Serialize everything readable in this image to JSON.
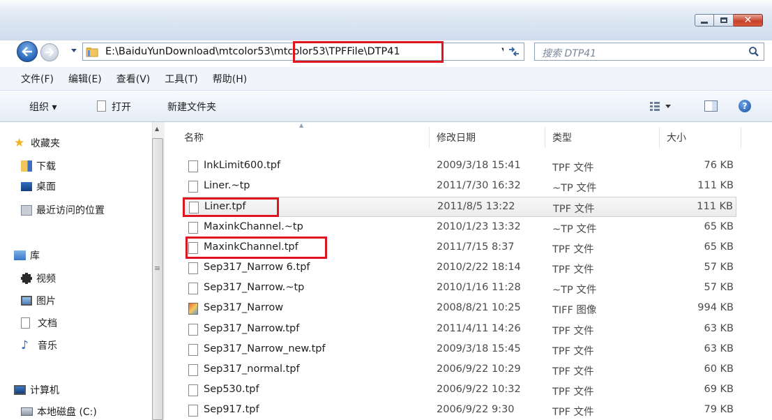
{
  "window": {
    "caption_buttons": [
      "minimize",
      "maximize",
      "close"
    ]
  },
  "address": {
    "path": "E:\\BaiduYunDownload\\mtcolor53\\mtcolor53\\TPFFile\\DTP41",
    "search_placeholder": "搜索 DTP41"
  },
  "menu": {
    "file": "文件(F)",
    "edit": "编辑(E)",
    "view": "查看(V)",
    "tools": "工具(T)",
    "help": "帮助(H)"
  },
  "toolbar": {
    "organize": "组织 ▾",
    "open": "打开",
    "new_folder": "新建文件夹"
  },
  "sidebar": {
    "favorites": "收藏夹",
    "downloads": "下载",
    "desktop": "桌面",
    "recent": "最近访问的位置",
    "libraries": "库",
    "videos": "视频",
    "pictures": "图片",
    "documents": "文档",
    "music": "音乐",
    "computer": "计算机",
    "local_disk": "本地磁盘 (C:)"
  },
  "columns": {
    "name": "名称",
    "date": "修改日期",
    "type": "类型",
    "size": "大小"
  },
  "files": [
    {
      "name": "InkLimit600.tpf",
      "date": "2009/3/18 15:41",
      "type": "TPF 文件",
      "size": "76 KB"
    },
    {
      "name": "Liner.~tp",
      "date": "2011/7/30 16:32",
      "type": "~TP 文件",
      "size": "111 KB"
    },
    {
      "name": "Liner.tpf",
      "date": "2011/8/5 13:22",
      "type": "TPF 文件",
      "size": "111 KB"
    },
    {
      "name": "MaxinkChannel.~tp",
      "date": "2010/1/23 13:32",
      "type": "~TP 文件",
      "size": "65 KB"
    },
    {
      "name": "MaxinkChannel.tpf",
      "date": "2011/7/15 8:37",
      "type": "TPF 文件",
      "size": "65 KB"
    },
    {
      "name": "Sep317_Narrow 6.tpf",
      "date": "2010/2/22 18:14",
      "type": "TPF 文件",
      "size": "57 KB"
    },
    {
      "name": "Sep317_Narrow.~tp",
      "date": "2010/1/16 11:28",
      "type": "~TP 文件",
      "size": "57 KB"
    },
    {
      "name": "Sep317_Narrow",
      "date": "2008/8/21 10:25",
      "type": "TIFF 图像",
      "size": "994 KB"
    },
    {
      "name": "Sep317_Narrow.tpf",
      "date": "2011/4/11 14:26",
      "type": "TPF 文件",
      "size": "63 KB"
    },
    {
      "name": "Sep317_Narrow_new.tpf",
      "date": "2009/3/18 15:45",
      "type": "TPF 文件",
      "size": "63 KB"
    },
    {
      "name": "Sep317_normal.tpf",
      "date": "2006/9/22 10:29",
      "type": "TPF 文件",
      "size": "60 KB"
    },
    {
      "name": "Sep530.tpf",
      "date": "2006/9/22 10:32",
      "type": "TPF 文件",
      "size": "69 KB"
    },
    {
      "name": "Sep917.tpf",
      "date": "2006/9/22 9:30",
      "type": "TPF 文件",
      "size": "79 KB"
    }
  ],
  "colors": {
    "highlight_box": "#e0141e",
    "close_button": "#c7412a",
    "selected_row": "#ebebeb"
  }
}
